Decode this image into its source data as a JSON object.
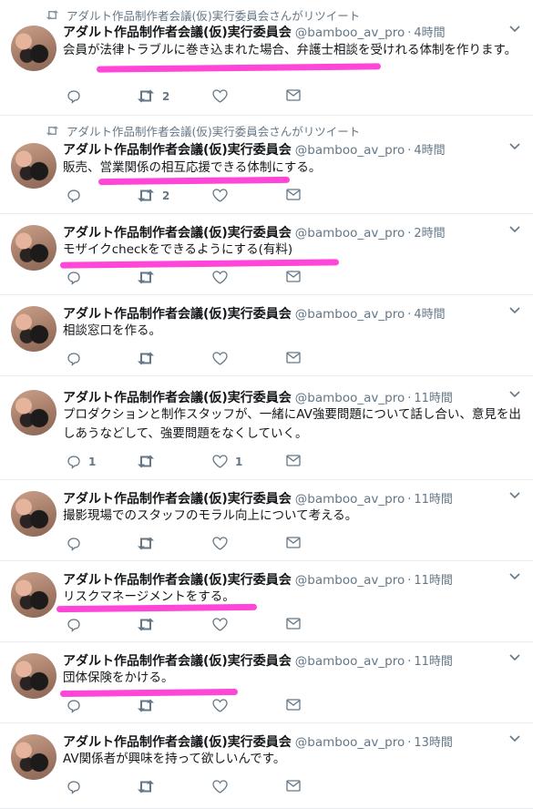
{
  "account": {
    "name": "アダルト作品制作者会議(仮)実行委員会",
    "handle": "@bamboo_av_pro"
  },
  "retweet_label": "アダルト作品制作者会議(仮)実行委員会さんがリツイート",
  "tweets": [
    {
      "time": "4時間",
      "text": "会員が法律トラブルに巻き込まれた場合、弁護士相談を受けれる体制を作ります。",
      "retweets": "2"
    },
    {
      "time": "4時間",
      "text": "販売、営業関係の相互応援できる体制にする。",
      "retweets": "2"
    },
    {
      "time": "2時間",
      "text": "モザイクcheckをできるようにする(有料)"
    },
    {
      "time": "4時間",
      "text": "相談窓口を作る。"
    },
    {
      "time": "11時間",
      "text": "プロダクションと制作スタッフが、一緒にAV強要問題について話し合い、意見を出しあうなどして、強要問題をなくしていく。",
      "replies": "1",
      "likes": "1"
    },
    {
      "time": "11時間",
      "text": "撮影現場でのスタッフのモラル向上について考える。"
    },
    {
      "time": "11時間",
      "text": "リスクマネージメントをする。"
    },
    {
      "time": "11時間",
      "text": "団体保険をかける。"
    },
    {
      "time": "13時間",
      "text": "AV関係者が興味を持って欲しいんです。"
    }
  ],
  "icons": [
    "retweet-icon",
    "reply-icon",
    "like-icon",
    "dm-icon",
    "chevron-down-icon"
  ],
  "colors": {
    "highlight": "#ff36d6",
    "muted": "#657786",
    "text": "#14171a"
  }
}
